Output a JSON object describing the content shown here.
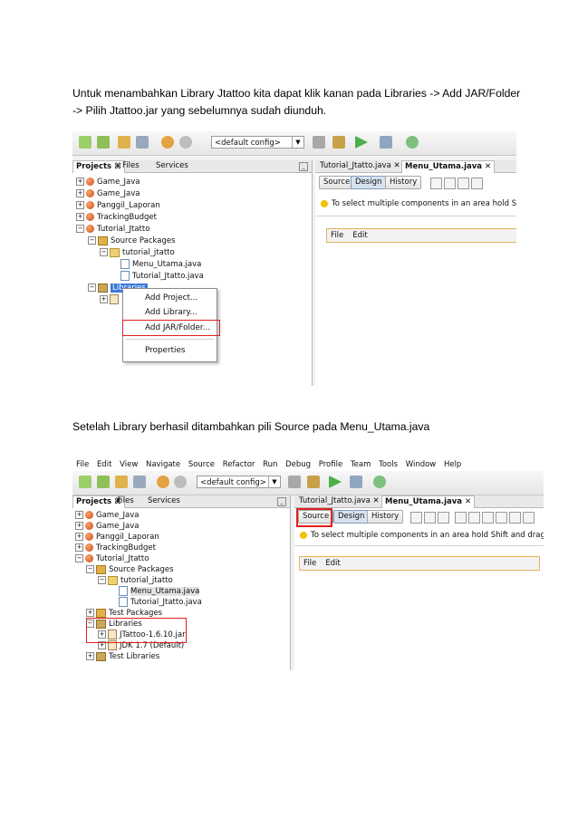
{
  "paragraph1": {
    "line1": "Untuk menambahkan Library Jtattoo kita dapat klik kanan pada Libraries -> Add JAR/Folder",
    "line2": "-> Pilih Jtattoo.jar yang sebelumnya sudah diunduh."
  },
  "paragraph2": "Setelah Library berhasil ditambahkan pili Source pada Menu_Utama.java",
  "shot1": {
    "combo": "<default config>",
    "panel_tabs": [
      "Projects",
      "Files",
      "Services"
    ],
    "tree": [
      "Game_Java",
      "Game_Java",
      "Panggil_Laporan",
      "TrackingBudget",
      "Tutorial_Jtatto",
      "Source Packages",
      "tutorial_jtatto",
      "Menu_Utama.java",
      "Tutorial_Jtatto.java",
      "Libraries"
    ],
    "editor_tabs": [
      "Tutorial_Jtatto.java",
      "Menu_Utama.java"
    ],
    "view_buttons": [
      "Source",
      "Design",
      "History"
    ],
    "hint": "To select multiple components in an area hold Shift and c",
    "form_menus": [
      "File",
      "Edit"
    ],
    "context_menu": [
      "Add Project...",
      "Add Library...",
      "Add JAR/Folder...",
      "Properties"
    ]
  },
  "shot2": {
    "menubar": [
      "File",
      "Edit",
      "View",
      "Navigate",
      "Source",
      "Refactor",
      "Run",
      "Debug",
      "Profile",
      "Team",
      "Tools",
      "Window",
      "Help"
    ],
    "combo": "<default config>",
    "panel_tabs": [
      "Projects",
      "Files",
      "Services"
    ],
    "tree": [
      "Game_Java",
      "Game_Java",
      "Panggil_Laporan",
      "TrackingBudget",
      "Tutorial_Jtatto",
      "Source Packages",
      "tutorial_jtatto",
      "Menu_Utama.java",
      "Tutorial_Jtatto.java",
      "Test Packages",
      "Libraries",
      "JTattoo-1.6.10.jar",
      "JDK 1.7 (Default)",
      "Test Libraries"
    ],
    "editor_tabs": [
      "Tutorial_Jtatto.java",
      "Menu_Utama.java"
    ],
    "view_buttons": [
      "Source",
      "Design",
      "History"
    ],
    "hint": "To select multiple components in an area hold Shift and drag mouse over the comp",
    "form_menus": [
      "File",
      "Edit"
    ]
  },
  "colors": {
    "highlight_box": "#e02020",
    "selection": "#3a78d8",
    "form_menu_border": "#e3b45c"
  }
}
